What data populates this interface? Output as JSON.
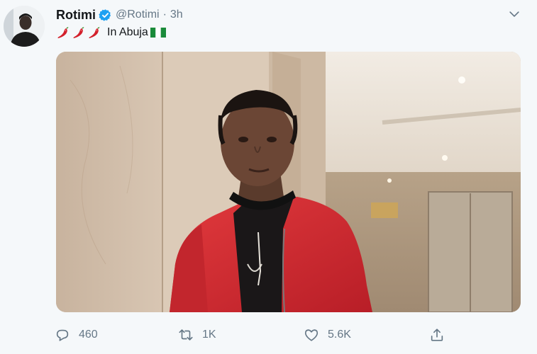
{
  "tweet": {
    "display_name": "Rotimi",
    "handle": "@Rotimi",
    "separator": "·",
    "time": "3h",
    "text": "In Abuja",
    "emoji": [
      "hot-pepper-icon",
      "hot-pepper-icon",
      "hot-pepper-icon"
    ],
    "flag": "nigeria-flag-icon",
    "verified": true
  },
  "media": {
    "alt": "Photo of man in red bomber jacket leaning against marble wall"
  },
  "actions": {
    "reply": {
      "icon": "reply-icon",
      "count": "460"
    },
    "retweet": {
      "icon": "retweet-icon",
      "count": "1K"
    },
    "like": {
      "icon": "like-icon",
      "count": "5.6K"
    },
    "share": {
      "icon": "share-icon"
    }
  },
  "colors": {
    "background": "#f5f8fa",
    "verified": "#1da1f2",
    "secondary_text": "#657786",
    "jacket_red": "#d92b33"
  }
}
